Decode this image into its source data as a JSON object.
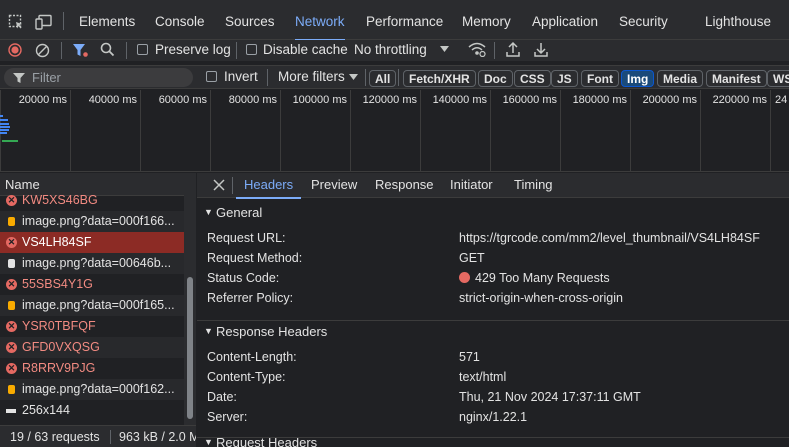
{
  "tabs": [
    "Elements",
    "Console",
    "Sources",
    "Network",
    "Performance",
    "Memory",
    "Application",
    "Security",
    "Lighthouse"
  ],
  "toolbar": {
    "preserve_log": "Preserve log",
    "disable_cache": "Disable cache",
    "throttling": "No throttling"
  },
  "filterbar": {
    "placeholder": "Filter",
    "invert": "Invert",
    "more_filters": "More filters",
    "types": [
      "All",
      "Fetch/XHR",
      "Doc",
      "CSS",
      "JS",
      "Font",
      "Img",
      "Media",
      "Manifest",
      "WS"
    ],
    "active_type": "Img"
  },
  "overview": {
    "ticks": [
      "20000 ms",
      "40000 ms",
      "60000 ms",
      "80000 ms",
      "100000 ms",
      "120000 ms",
      "140000 ms",
      "160000 ms",
      "180000 ms",
      "200000 ms",
      "220000 ms",
      "24"
    ]
  },
  "request_list": {
    "header": "Name",
    "rows": [
      {
        "name": "KW5XS46BG",
        "icon": "error-icon",
        "error": true
      },
      {
        "name": "image.png?data=000f166...",
        "icon": "image-icon",
        "error": false
      },
      {
        "name": "VS4LH84SF",
        "icon": "error-icon",
        "error": true,
        "selected": true
      },
      {
        "name": "image.png?data=00646b...",
        "icon": "image-icon",
        "error": false
      },
      {
        "name": "55SBS4Y1G",
        "icon": "error-icon",
        "error": true
      },
      {
        "name": "image.png?data=000f165...",
        "icon": "image-icon",
        "error": false
      },
      {
        "name": "YSR0TBFQF",
        "icon": "error-icon",
        "error": true
      },
      {
        "name": "GFD0VXQSG",
        "icon": "error-icon",
        "error": true
      },
      {
        "name": "R8RRV9PJG",
        "icon": "error-icon",
        "error": true
      },
      {
        "name": "image.png?data=000f162...",
        "icon": "image-icon",
        "error": false
      },
      {
        "name": "256x144",
        "icon": "image-icon",
        "error": false
      }
    ],
    "status_requests": "19 / 63 requests",
    "status_size": "963 kB / 2.0 M"
  },
  "detail": {
    "tabs": [
      "Headers",
      "Preview",
      "Response",
      "Initiator",
      "Timing"
    ],
    "general": {
      "title": "General",
      "rows": [
        {
          "key": "Request URL:",
          "value": "https://tgrcode.com/mm2/level_thumbnail/VS4LH84SF"
        },
        {
          "key": "Request Method:",
          "value": "GET"
        },
        {
          "key": "Status Code:",
          "value": "429 Too Many Requests"
        },
        {
          "key": "Referrer Policy:",
          "value": "strict-origin-when-cross-origin"
        }
      ]
    },
    "response_headers": {
      "title": "Response Headers",
      "rows": [
        {
          "key": "Content-Length:",
          "value": "571"
        },
        {
          "key": "Content-Type:",
          "value": "text/html"
        },
        {
          "key": "Date:",
          "value": "Thu, 21 Nov 2024 17:37:11 GMT"
        },
        {
          "key": "Server:",
          "value": "nginx/1.22.1"
        }
      ]
    },
    "request_headers_title": "Request Headers"
  },
  "colors": {
    "accent": "#7cacf8",
    "error": "#e46962",
    "selected_row": "#8c2b25"
  }
}
